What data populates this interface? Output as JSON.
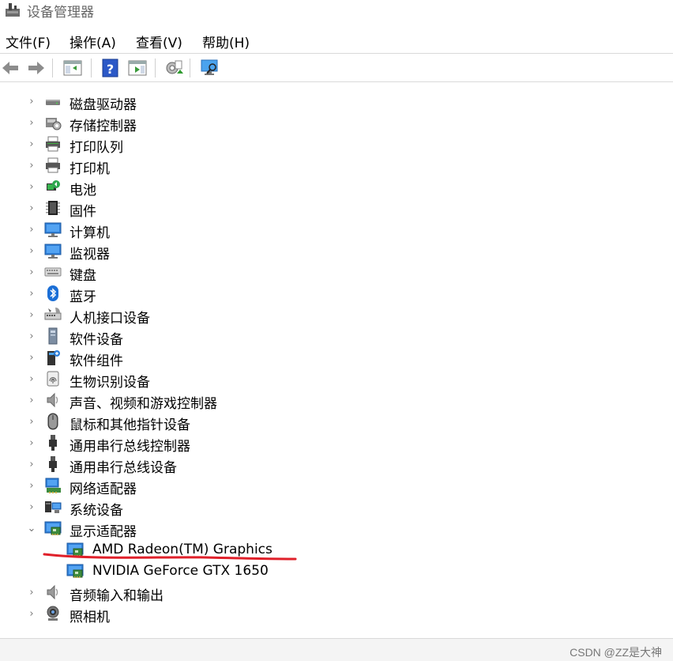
{
  "window": {
    "title": "设备管理器",
    "title_icon": "device-manager-icon"
  },
  "menu": {
    "file": "文件(F)",
    "action": "操作(A)",
    "view": "查看(V)",
    "help": "帮助(H)"
  },
  "toolbar": [
    "back-arrow-icon",
    "forward-arrow-icon",
    "show-hide-tree-icon",
    "help-icon",
    "properties-icon",
    "update-driver-icon",
    "scan-hardware-icon"
  ],
  "tree": {
    "items": [
      {
        "label": "磁盘驱动器",
        "icon": "disk-drive-icon",
        "state": "collapsed"
      },
      {
        "label": "存储控制器",
        "icon": "storage-controller-icon",
        "state": "collapsed"
      },
      {
        "label": "打印队列",
        "icon": "print-queue-icon",
        "state": "collapsed"
      },
      {
        "label": "打印机",
        "icon": "printer-icon",
        "state": "collapsed"
      },
      {
        "label": "电池",
        "icon": "battery-icon",
        "state": "collapsed"
      },
      {
        "label": "固件",
        "icon": "firmware-icon",
        "state": "collapsed"
      },
      {
        "label": "计算机",
        "icon": "computer-icon",
        "state": "collapsed"
      },
      {
        "label": "监视器",
        "icon": "monitor-icon",
        "state": "collapsed"
      },
      {
        "label": "键盘",
        "icon": "keyboard-icon",
        "state": "collapsed"
      },
      {
        "label": "蓝牙",
        "icon": "bluetooth-icon",
        "state": "collapsed"
      },
      {
        "label": "人机接口设备",
        "icon": "hid-icon",
        "state": "collapsed"
      },
      {
        "label": "软件设备",
        "icon": "software-device-icon",
        "state": "collapsed"
      },
      {
        "label": "软件组件",
        "icon": "software-component-icon",
        "state": "collapsed"
      },
      {
        "label": "生物识别设备",
        "icon": "biometric-icon",
        "state": "collapsed"
      },
      {
        "label": "声音、视频和游戏控制器",
        "icon": "speaker-icon",
        "state": "collapsed"
      },
      {
        "label": "鼠标和其他指针设备",
        "icon": "mouse-icon",
        "state": "collapsed"
      },
      {
        "label": "通用串行总线控制器",
        "icon": "usb-icon",
        "state": "collapsed"
      },
      {
        "label": "通用串行总线设备",
        "icon": "usb-icon",
        "state": "collapsed"
      },
      {
        "label": "网络适配器",
        "icon": "network-adapter-icon",
        "state": "collapsed"
      },
      {
        "label": "系统设备",
        "icon": "system-device-icon",
        "state": "collapsed"
      },
      {
        "label": "显示适配器",
        "icon": "display-adapter-icon",
        "state": "expanded"
      },
      {
        "label": "AMD Radeon(TM) Graphics",
        "icon": "display-adapter-icon",
        "state": "child"
      },
      {
        "label": "NVIDIA GeForce GTX 1650",
        "icon": "display-adapter-icon",
        "state": "child"
      },
      {
        "label": "音频输入和输出",
        "icon": "speaker-icon",
        "state": "collapsed"
      },
      {
        "label": "照相机",
        "icon": "camera-icon",
        "state": "collapsed"
      }
    ]
  },
  "watermark": "CSDN @ZZ是大神",
  "colors": {
    "annotation": "#e0202a",
    "monitor_blue": "#2f7fd8",
    "pcb_green": "#3d8b3d"
  }
}
